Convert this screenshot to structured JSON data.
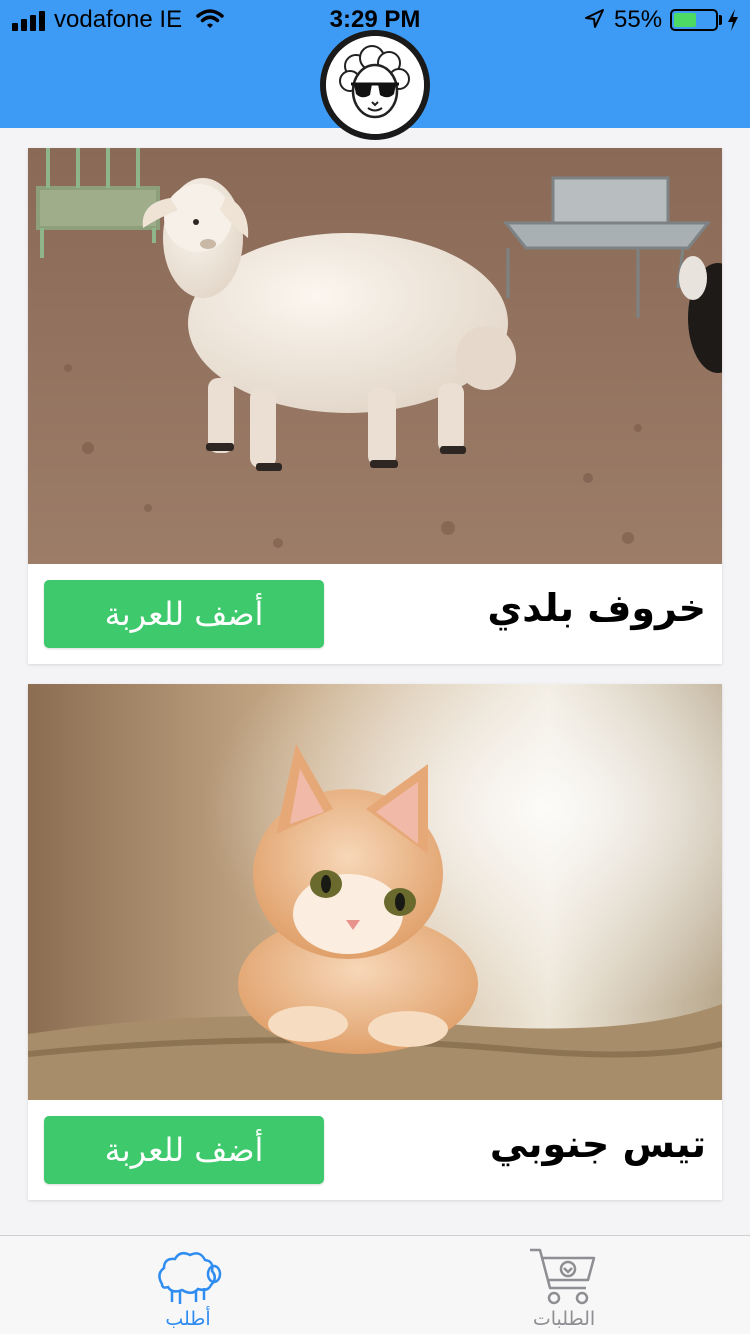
{
  "status_bar": {
    "carrier": "vodafone IE",
    "time": "3:29 PM",
    "battery_percent": "55%",
    "battery_level": 0.55
  },
  "header": {
    "logo_icon": "sheep-with-sunglasses-logo",
    "color": "#3d9bf5"
  },
  "products": [
    {
      "title": "خروف بلدي",
      "button_label": "أضف للعربة",
      "image": "white-sheep-photo"
    },
    {
      "title": "تيس جنوبي",
      "button_label": "أضف للعربة",
      "image": "kitten-photo"
    }
  ],
  "tab_bar": {
    "tabs": [
      {
        "label": "أطلب",
        "icon": "sheep-icon",
        "active": true
      },
      {
        "label": "الطلبات",
        "icon": "cart-icon",
        "active": false
      }
    ]
  },
  "colors": {
    "accent": "#3d9bf5",
    "button": "#3ec96c",
    "active_tab": "#2f8cf0",
    "inactive_tab": "#8e8e93"
  }
}
